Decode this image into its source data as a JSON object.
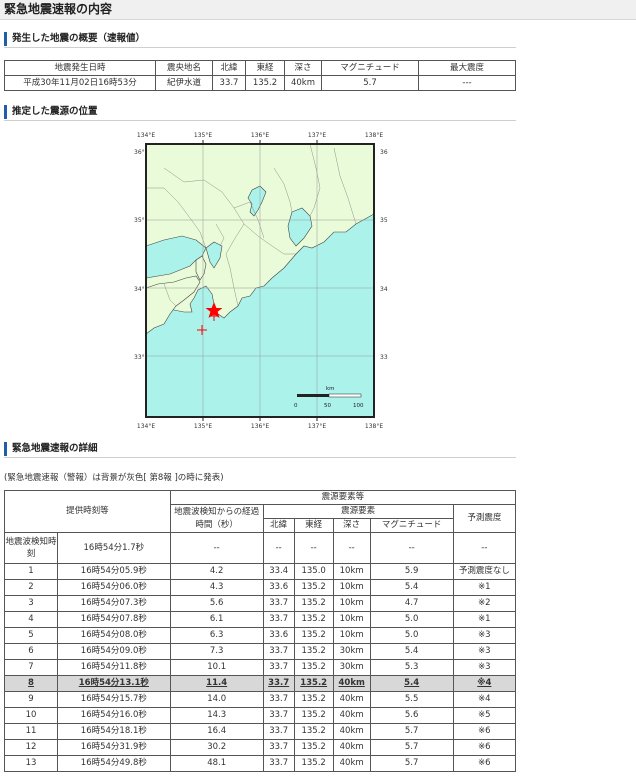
{
  "page_title": "緊急地震速報の内容",
  "section1": {
    "title": "発生した地震の概要（速報値）"
  },
  "overview": {
    "headers": [
      "地震発生日時",
      "震央地名",
      "北緯",
      "東経",
      "深さ",
      "マグニチュード",
      "最大震度"
    ],
    "values": [
      "平成30年11月02日16時53分",
      "紀伊水道",
      "33.7",
      "135.2",
      "40km",
      "5.7",
      "---"
    ]
  },
  "section2": {
    "title": "推定した震源の位置"
  },
  "map": {
    "lon_ticks": [
      "134°E",
      "135°E",
      "136°E",
      "137°E",
      "138°E"
    ],
    "lat_ticks": [
      "36°N",
      "35°N",
      "34°N",
      "33°N"
    ],
    "scale_unit": "km",
    "scale_labels": [
      "0",
      "50",
      "100"
    ],
    "colors": {
      "sea": "#aaf2ea",
      "land": "#e9fbd8",
      "epicenter": "#ff0000"
    },
    "epicenter_icon": "star-icon",
    "estimate_icon": "cross-icon"
  },
  "section3": {
    "title": "緊急地震速報の詳細"
  },
  "note": "(緊急地震速報（警報）は背景が灰色[ 第8報 ]の時に発表)",
  "detail": {
    "header_top": "震源要素等",
    "header_sub": "震源要素",
    "col_provided": "提供時刻等",
    "col_elapsed": "地震波検知からの経過時間（秒）",
    "col_lat": "北緯",
    "col_lon": "東経",
    "col_depth": "深さ",
    "col_mag": "マグニチュード",
    "col_intensity": "予測震度",
    "detect_label": "地震波検知時刻",
    "detect_time": "16時54分1.7秒",
    "detect_values": [
      "--",
      "--",
      "--",
      "--",
      "--",
      "--"
    ],
    "rows": [
      [
        "1",
        "16時54分05.9秒",
        "4.2",
        "33.4",
        "135.0",
        "10km",
        "5.9",
        "予測震度なし"
      ],
      [
        "2",
        "16時54分06.0秒",
        "4.3",
        "33.6",
        "135.2",
        "10km",
        "5.4",
        "※1"
      ],
      [
        "3",
        "16時54分07.3秒",
        "5.6",
        "33.7",
        "135.2",
        "10km",
        "4.7",
        "※2"
      ],
      [
        "4",
        "16時54分07.8秒",
        "6.1",
        "33.7",
        "135.2",
        "10km",
        "5.0",
        "※1"
      ],
      [
        "5",
        "16時54分08.0秒",
        "6.3",
        "33.6",
        "135.2",
        "10km",
        "5.0",
        "※3"
      ],
      [
        "6",
        "16時54分09.0秒",
        "7.3",
        "33.7",
        "135.2",
        "30km",
        "5.4",
        "※3"
      ],
      [
        "7",
        "16時54分11.8秒",
        "10.1",
        "33.7",
        "135.2",
        "30km",
        "5.3",
        "※3"
      ],
      [
        "8",
        "16時54分13.1秒",
        "11.4",
        "33.7",
        "135.2",
        "40km",
        "5.4",
        "※4"
      ],
      [
        "9",
        "16時54分15.7秒",
        "14.0",
        "33.7",
        "135.2",
        "40km",
        "5.5",
        "※4"
      ],
      [
        "10",
        "16時54分16.0秒",
        "14.3",
        "33.7",
        "135.2",
        "40km",
        "5.6",
        "※5"
      ],
      [
        "11",
        "16時54分18.1秒",
        "16.4",
        "33.7",
        "135.2",
        "40km",
        "5.7",
        "※6"
      ],
      [
        "12",
        "16時54分31.9秒",
        "30.2",
        "33.7",
        "135.2",
        "40km",
        "5.7",
        "※6"
      ],
      [
        "13",
        "16時54分49.8秒",
        "48.1",
        "33.7",
        "135.2",
        "40km",
        "5.7",
        "※6"
      ]
    ],
    "highlight_row": "8"
  }
}
